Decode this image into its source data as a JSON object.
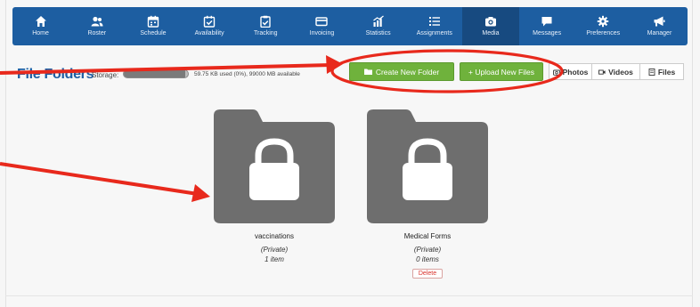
{
  "nav": {
    "items": [
      {
        "label": "Home",
        "icon": "home-icon"
      },
      {
        "label": "Roster",
        "icon": "users-icon"
      },
      {
        "label": "Schedule",
        "icon": "calendar-icon"
      },
      {
        "label": "Availability",
        "icon": "calendar-check-icon"
      },
      {
        "label": "Tracking",
        "icon": "clipboard-icon"
      },
      {
        "label": "Invoicing",
        "icon": "credit-card-icon"
      },
      {
        "label": "Statistics",
        "icon": "chart-icon"
      },
      {
        "label": "Assignments",
        "icon": "list-icon"
      },
      {
        "label": "Media",
        "icon": "camera-icon"
      },
      {
        "label": "Messages",
        "icon": "chat-icon"
      },
      {
        "label": "Preferences",
        "icon": "gear-icon"
      },
      {
        "label": "Manager",
        "icon": "megaphone-icon"
      }
    ],
    "active": "Media"
  },
  "header": {
    "title": "File Folders",
    "storage_label": "Storage:",
    "storage_used_fraction": 0.0,
    "storage_text": "59.75 KB used (0%), 99000 MB available"
  },
  "toolbar": {
    "create_label": "Create New Folder",
    "upload_label": "+ Upload New Files",
    "photos_label": "Photos",
    "videos_label": "Videos",
    "files_label": "Files"
  },
  "folders": [
    {
      "name": "vaccinations",
      "privacy": "(Private)",
      "count": "1 item"
    },
    {
      "name": "Medical Forms",
      "privacy": "(Private)",
      "count": "0 items",
      "delete_label": "Delete"
    }
  ],
  "colors": {
    "nav_bg": "#1d5ea1",
    "nav_active": "#174a80",
    "title": "#1e5ea3",
    "green": "#6fb23c",
    "annotation_red": "#e8291c",
    "folder_gray": "#6e6e6e"
  }
}
